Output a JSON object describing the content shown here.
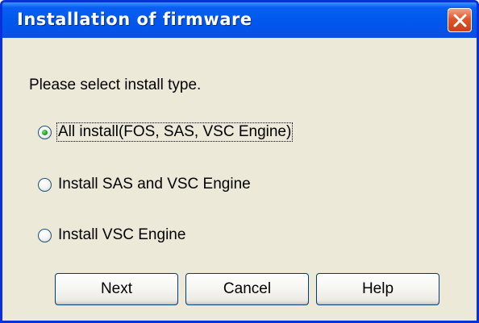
{
  "window": {
    "title": "Installation of firmware"
  },
  "dialog": {
    "prompt": "Please select install type.",
    "options": [
      {
        "label": "All install(FOS, SAS, VSC Engine)",
        "selected": true
      },
      {
        "label": "Install SAS and VSC Engine",
        "selected": false
      },
      {
        "label": "Install VSC Engine",
        "selected": false
      }
    ]
  },
  "buttons": {
    "next": "Next",
    "cancel": "Cancel",
    "help": "Help"
  },
  "colors": {
    "titlebar": "#0058ee",
    "close_button": "#e0552b",
    "dialog_background": "#ece9d8",
    "radio_selected_dot": "#21a121"
  },
  "icons": {
    "close": "close-icon"
  }
}
